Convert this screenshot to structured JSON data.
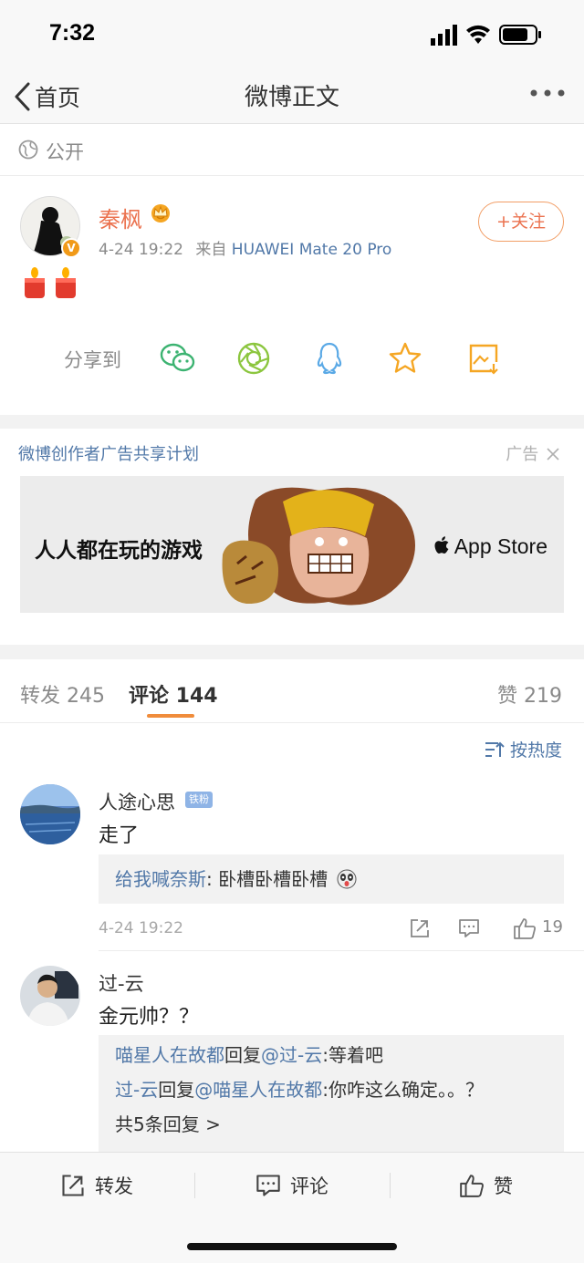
{
  "status_bar": {
    "time": "7:32"
  },
  "nav": {
    "back_label": "首页",
    "title": "微博正文"
  },
  "visibility": {
    "label": "公开"
  },
  "post": {
    "author": "秦枫",
    "date": "4-24 19:22",
    "source_prefix": "来自",
    "device": "HUAWEI Mate 20 Pro",
    "follow_label": "+关注",
    "share_label": "分享到"
  },
  "ad": {
    "title": "微博创作者广告共享计划",
    "tag": "广告",
    "banner_text": "人人都在玩的游戏",
    "store_text": "App Store"
  },
  "tabs": {
    "repost": "转发 245",
    "comments": "评论 144",
    "likes": "赞 219"
  },
  "sort": {
    "label": "按热度"
  },
  "comments": [
    {
      "name": "人途心思",
      "badge": "铁粉",
      "text": "走了",
      "replies": [
        {
          "user": "给我喊奈斯",
          "text": ": 卧槽卧槽卧槽"
        }
      ],
      "time": "4-24 19:22",
      "likes": "19"
    },
    {
      "name": "过-云",
      "text": "金元帅？？",
      "replies": [
        {
          "user": "喵星人在故都",
          "mid": "回复",
          "target": "@过-云",
          "text": ":等着吧"
        },
        {
          "user": "过-云",
          "mid": "回复",
          "target": "@喵星人在故都",
          "text": ":你咋这么确定。。？"
        }
      ],
      "more": "共5条回复 >"
    }
  ],
  "bottom_bar": {
    "repost": "转发",
    "comment": "评论",
    "like": "赞"
  },
  "colors": {
    "accent": "#eb7350",
    "link": "#5178a8",
    "tab_underline": "#f08c3b"
  }
}
